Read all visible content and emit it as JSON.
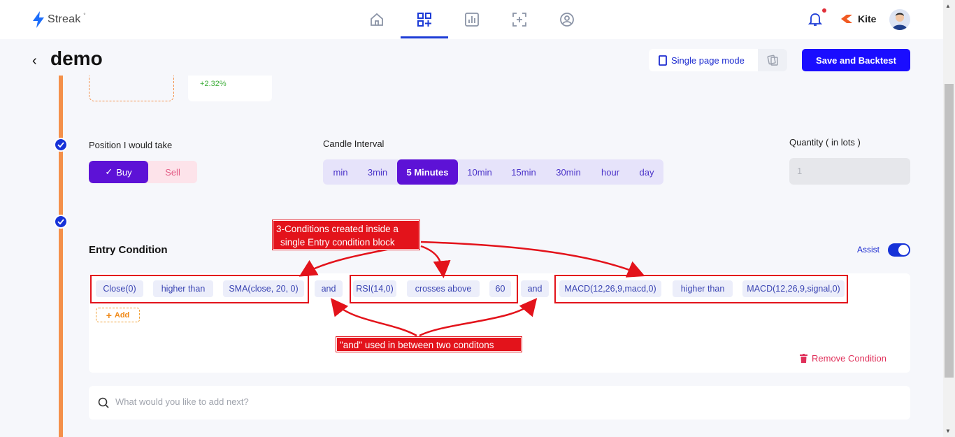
{
  "app": {
    "logo_text": "Streak",
    "logo_mark": "˚"
  },
  "nav": {
    "items": [
      {
        "name": "home-icon"
      },
      {
        "name": "strategy-builder-icon",
        "active": true
      },
      {
        "name": "chart-icon"
      },
      {
        "name": "scanner-icon"
      },
      {
        "name": "profile-icon"
      }
    ],
    "broker": "Kite"
  },
  "header": {
    "title": "demo",
    "single_page_mode": "Single page mode",
    "save_button": "Save and Backtest"
  },
  "instrument_card": {
    "change": "+2.32%"
  },
  "position": {
    "label": "Position I would take",
    "buy": "Buy",
    "sell": "Sell",
    "selected": "Buy"
  },
  "candle_interval": {
    "label": "Candle Interval",
    "options": [
      "min",
      "3min",
      "5 Minutes",
      "10min",
      "15min",
      "30min",
      "hour",
      "day"
    ],
    "selected": "5 Minutes"
  },
  "quantity": {
    "label": "Quantity ( in lots )",
    "placeholder": "1"
  },
  "entry": {
    "title": "Entry Condition",
    "assist_label": "Assist",
    "assist_on": true,
    "chips": [
      "Close(0)",
      "higher than",
      "SMA(close, 20, 0)",
      "and",
      "RSI(14,0)",
      "crosses above",
      "60",
      "and",
      "MACD(12,26,9,macd,0)",
      "higher than",
      "MACD(12,26,9,signal,0)"
    ],
    "add_label": "Add",
    "remove_label": "Remove Condition"
  },
  "search": {
    "placeholder": "What would you like to add next?"
  },
  "annotations": {
    "callout_top_line1": "3-Conditions created inside a",
    "callout_top_line2": "single Entry condition block",
    "callout_bottom": "\"and\" used in between two conditons"
  },
  "colors": {
    "primary": "#1a0dff",
    "purple": "#5d12d6",
    "timeline": "#f4904a",
    "annotation_red": "#e3131b"
  }
}
